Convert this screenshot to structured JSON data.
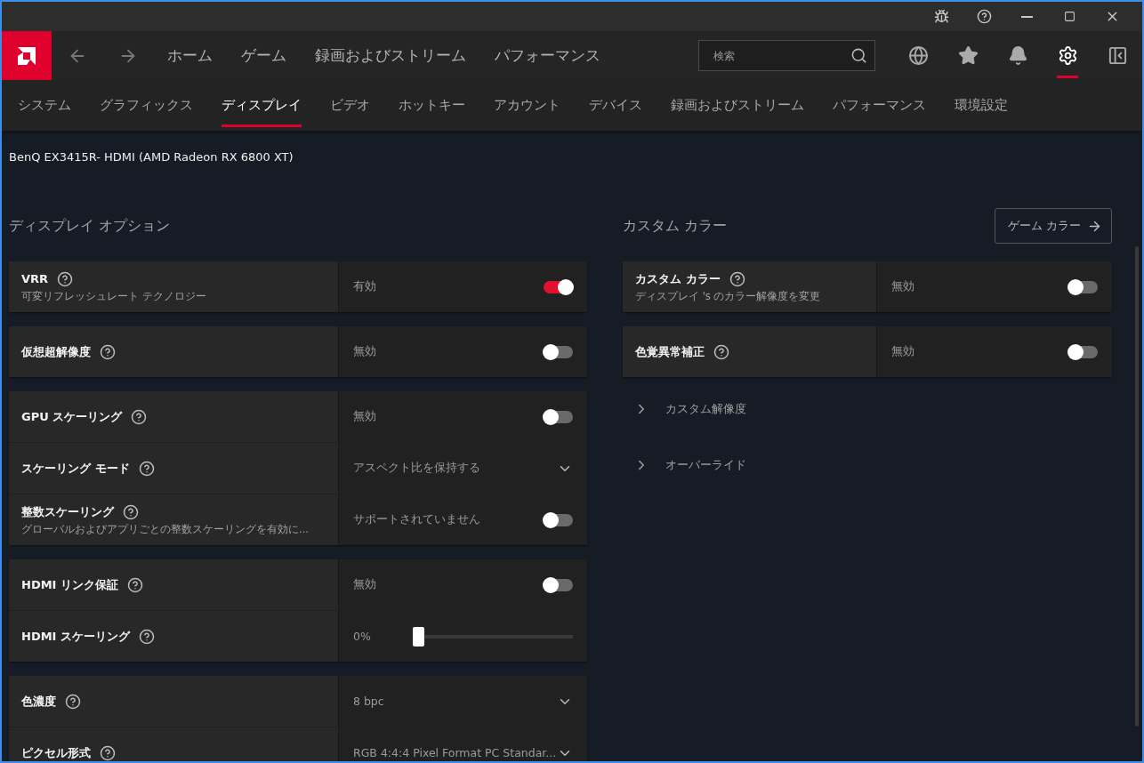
{
  "title_bar": {
    "buttons": [
      {
        "kind": "bug"
      },
      {
        "kind": "help"
      },
      {
        "kind": "minimize"
      },
      {
        "kind": "maximize"
      },
      {
        "kind": "close"
      }
    ]
  },
  "top_nav": {
    "items": [
      {
        "label": "ホーム",
        "selected": false
      },
      {
        "label": "ゲーム",
        "selected": false
      },
      {
        "label": "録画およびストリーム",
        "selected": false
      },
      {
        "label": "パフォーマンス",
        "selected": false
      }
    ],
    "search": {
      "placeholder": "検索"
    },
    "icons": [
      {
        "kind": "globe",
        "selected": false
      },
      {
        "kind": "star",
        "selected": false
      },
      {
        "kind": "bell",
        "selected": false
      },
      {
        "kind": "gear",
        "selected": true
      },
      {
        "kind": "panel",
        "selected": false
      }
    ]
  },
  "tabs": [
    {
      "label": "システム",
      "selected": false
    },
    {
      "label": "グラフィックス",
      "selected": false
    },
    {
      "label": "ディスプレイ",
      "selected": true
    },
    {
      "label": "ビデオ",
      "selected": false
    },
    {
      "label": "ホットキー",
      "selected": false
    },
    {
      "label": "アカウント",
      "selected": false
    },
    {
      "label": "デバイス",
      "selected": false
    },
    {
      "label": "録画およびストリーム",
      "selected": false
    },
    {
      "label": "パフォーマンス",
      "selected": false
    },
    {
      "label": "環境設定",
      "selected": false
    }
  ],
  "display_name": "BenQ EX3415R- HDMI (AMD Radeon RX 6800 XT)",
  "left": {
    "title": "ディスプレイ オプション",
    "groups": [
      {
        "rows": [
          {
            "kind": "toggle",
            "label": "VRR",
            "sub": "可変リフレッシュレート テクノロジー",
            "value": "有効",
            "on": true
          }
        ]
      },
      {
        "rows": [
          {
            "kind": "toggle",
            "label": "仮想超解像度",
            "value": "無効",
            "on": false
          }
        ]
      },
      {
        "rows": [
          {
            "kind": "toggle",
            "label": "GPU スケーリング",
            "value": "無効",
            "on": false
          },
          {
            "kind": "dropdown",
            "label": "スケーリング モード",
            "value": "アスペクト比を保持する"
          },
          {
            "kind": "toggle",
            "label": "整数スケーリング",
            "sub": "グローバルおよびアプリごとの整数スケーリングを有効に...",
            "value": "サポートされていません",
            "on": false
          }
        ]
      },
      {
        "rows": [
          {
            "kind": "toggle",
            "label": "HDMI リンク保証",
            "value": "無効",
            "on": false
          },
          {
            "kind": "slider",
            "label": "HDMI スケーリング",
            "value": "0%",
            "level": 0
          }
        ]
      },
      {
        "rows": [
          {
            "kind": "dropdown",
            "label": "色濃度",
            "value": "8 bpc"
          },
          {
            "kind": "dropdown",
            "label": "ピクセル形式",
            "value": "RGB 4:4:4 Pixel Format PC Standar..."
          }
        ]
      }
    ]
  },
  "right": {
    "title": "カスタム カラー",
    "button": "ゲーム カラー",
    "groups": [
      {
        "rows": [
          {
            "kind": "toggle",
            "label": "カスタム カラー",
            "sub": "ディスプレイ 's のカラー解像度を変更",
            "value": "無効",
            "on": false
          }
        ]
      },
      {
        "rows": [
          {
            "kind": "toggle",
            "label": "色覚異常補正",
            "value": "無効",
            "on": false
          }
        ]
      }
    ],
    "expanders": [
      {
        "label": "カスタム解像度",
        "expanded": false
      },
      {
        "label": "オーバーライド",
        "expanded": false
      }
    ]
  }
}
